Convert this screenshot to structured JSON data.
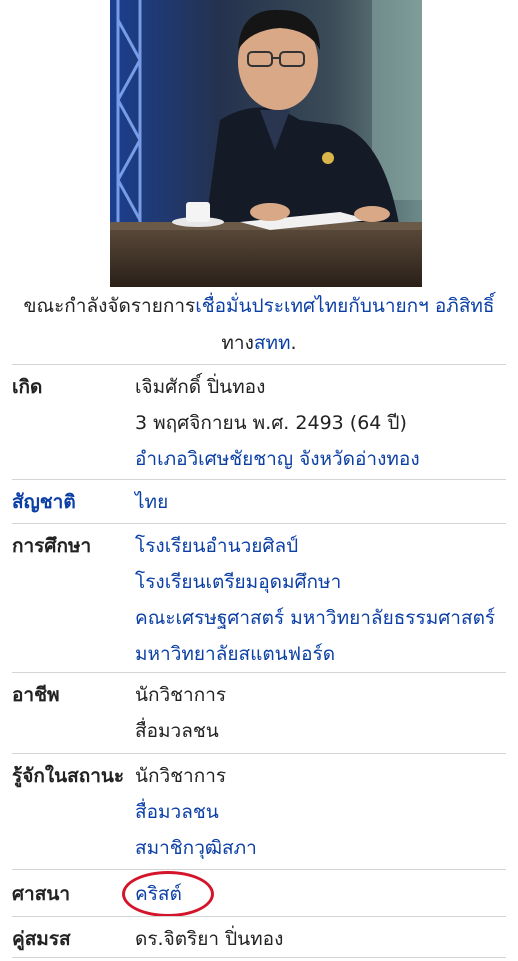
{
  "caption": {
    "prefix": "ขณะกำลังจัดรายการ",
    "program_link": "เชื่อมั่นประเทศไทยกับนายกฯ อภิสิทธิ์",
    "mid": "ทาง",
    "channel_link": "สทท",
    "suffix": "."
  },
  "infobox": {
    "born": {
      "label": "เกิด",
      "name": "เจิมศักดิ์ ปิ่นทอง",
      "date": "3 พฤศจิกายน พ.ศ. 2493 (64 ปี)",
      "place": "อำเภอวิเศษชัยชาญ จังหวัดอ่างทอง"
    },
    "nationality": {
      "label": "สัญชาติ",
      "value": "ไทย"
    },
    "education": {
      "label": "การศึกษา",
      "items": [
        "โรงเรียนอำนวยศิลป์",
        "โรงเรียนเตรียมอุดมศึกษา",
        "คณะเศรษฐศาสตร์ มหาวิทยาลัยธรรมศาสตร์",
        "มหาวิทยาลัยสแตนฟอร์ด"
      ]
    },
    "occupation": {
      "label": "อาชีพ",
      "items": [
        "นักวิชาการ",
        "สื่อมวลชน"
      ]
    },
    "known_for": {
      "label": "รู้จักในสถานะ",
      "items": [
        "นักวิชาการ",
        "สื่อมวลชน",
        "สมาชิกวุฒิสภา"
      ]
    },
    "religion": {
      "label": "ศาสนา",
      "value": "คริสต์"
    },
    "spouse": {
      "label": "คู่สมรส",
      "value": "ดร.จิตริยา ปิ่นทอง"
    }
  },
  "colors": {
    "link": "#0b3fa6",
    "highlight_circle": "#d3142a",
    "divider": "#d4d4d4"
  }
}
